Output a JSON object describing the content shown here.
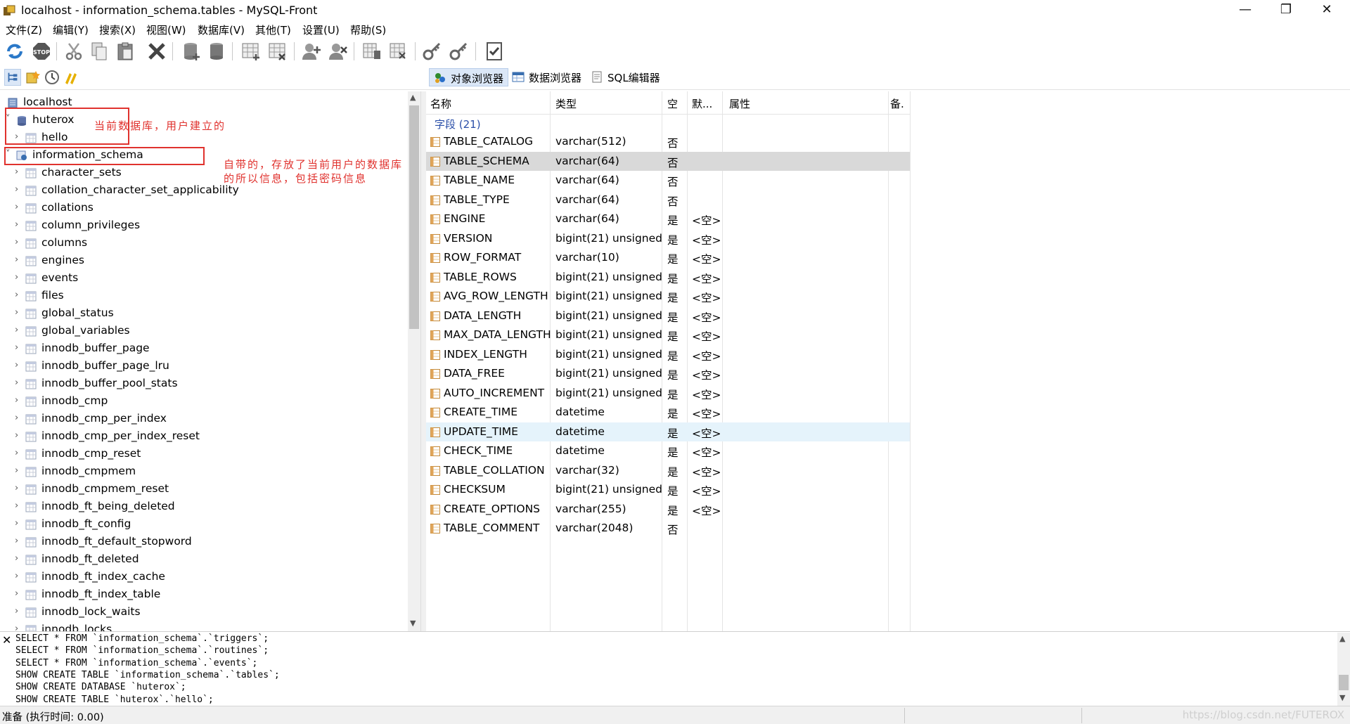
{
  "window": {
    "title": "localhost - information_schema.tables - MySQL-Front",
    "minimize": "—",
    "restore": "❐",
    "close": "✕"
  },
  "menu": [
    "文件(Z)",
    "编辑(Y)",
    "搜索(X)",
    "视图(W)",
    "数据库(V)",
    "其他(T)",
    "设置(U)",
    "帮助(S)"
  ],
  "view_tabs": [
    "对象浏览器",
    "数据浏览器",
    "SQL编辑器"
  ],
  "tree": {
    "root": "localhost",
    "user_db": "huterox",
    "user_db_table": "hello",
    "system_db": "information_schema",
    "tables": [
      "character_sets",
      "collation_character_set_applicability",
      "collations",
      "column_privileges",
      "columns",
      "engines",
      "events",
      "files",
      "global_status",
      "global_variables",
      "innodb_buffer_page",
      "innodb_buffer_page_lru",
      "innodb_buffer_pool_stats",
      "innodb_cmp",
      "innodb_cmp_per_index",
      "innodb_cmp_per_index_reset",
      "innodb_cmp_reset",
      "innodb_cmpmem",
      "innodb_cmpmem_reset",
      "innodb_ft_being_deleted",
      "innodb_ft_config",
      "innodb_ft_default_stopword",
      "innodb_ft_deleted",
      "innodb_ft_index_cache",
      "innodb_ft_index_table",
      "innodb_lock_waits",
      "innodb_locks"
    ]
  },
  "annotations": {
    "user_db_note": "当前数据库，用户建立的",
    "system_db_note_line1": "自带的，存放了当前用户的数据库",
    "system_db_note_line2": "的所以信息，包括密码信息"
  },
  "grid": {
    "headers": {
      "name": "名称",
      "type": "类型",
      "null": "空",
      "default": "默...",
      "attributes": "属性",
      "comment": "备."
    },
    "group_label": "字段 (21)",
    "rows": [
      {
        "name": "TABLE_CATALOG",
        "type": "varchar(512)",
        "null": "否",
        "default": ""
      },
      {
        "name": "TABLE_SCHEMA",
        "type": "varchar(64)",
        "null": "否",
        "default": ""
      },
      {
        "name": "TABLE_NAME",
        "type": "varchar(64)",
        "null": "否",
        "default": ""
      },
      {
        "name": "TABLE_TYPE",
        "type": "varchar(64)",
        "null": "否",
        "default": ""
      },
      {
        "name": "ENGINE",
        "type": "varchar(64)",
        "null": "是",
        "default": "<空>"
      },
      {
        "name": "VERSION",
        "type": "bigint(21) unsigned",
        "null": "是",
        "default": "<空>"
      },
      {
        "name": "ROW_FORMAT",
        "type": "varchar(10)",
        "null": "是",
        "default": "<空>"
      },
      {
        "name": "TABLE_ROWS",
        "type": "bigint(21) unsigned",
        "null": "是",
        "default": "<空>"
      },
      {
        "name": "AVG_ROW_LENGTH",
        "type": "bigint(21) unsigned",
        "null": "是",
        "default": "<空>"
      },
      {
        "name": "DATA_LENGTH",
        "type": "bigint(21) unsigned",
        "null": "是",
        "default": "<空>"
      },
      {
        "name": "MAX_DATA_LENGTH",
        "type": "bigint(21) unsigned",
        "null": "是",
        "default": "<空>"
      },
      {
        "name": "INDEX_LENGTH",
        "type": "bigint(21) unsigned",
        "null": "是",
        "default": "<空>"
      },
      {
        "name": "DATA_FREE",
        "type": "bigint(21) unsigned",
        "null": "是",
        "default": "<空>"
      },
      {
        "name": "AUTO_INCREMENT",
        "type": "bigint(21) unsigned",
        "null": "是",
        "default": "<空>"
      },
      {
        "name": "CREATE_TIME",
        "type": "datetime",
        "null": "是",
        "default": "<空>"
      },
      {
        "name": "UPDATE_TIME",
        "type": "datetime",
        "null": "是",
        "default": "<空>"
      },
      {
        "name": "CHECK_TIME",
        "type": "datetime",
        "null": "是",
        "default": "<空>"
      },
      {
        "name": "TABLE_COLLATION",
        "type": "varchar(32)",
        "null": "是",
        "default": "<空>"
      },
      {
        "name": "CHECKSUM",
        "type": "bigint(21) unsigned",
        "null": "是",
        "default": "<空>"
      },
      {
        "name": "CREATE_OPTIONS",
        "type": "varchar(255)",
        "null": "是",
        "default": "<空>"
      },
      {
        "name": "TABLE_COMMENT",
        "type": "varchar(2048)",
        "null": "否",
        "default": ""
      }
    ]
  },
  "sql_log": [
    "SELECT * FROM `information_schema`.`triggers`;",
    "SELECT * FROM `information_schema`.`routines`;",
    "SELECT * FROM `information_schema`.`events`;",
    "SHOW CREATE TABLE `information_schema`.`tables`;",
    "SHOW CREATE DATABASE `huterox`;",
    "SHOW CREATE TABLE `huterox`.`hello`;"
  ],
  "status": {
    "text": "准备  (执行时间: 0.00)",
    "watermark": "https://blog.csdn.net/FUTEROX"
  },
  "colors": {
    "annotation": "#e0322e",
    "selected_row": "#d9d9d9",
    "hover_row": "#e5f3fb",
    "group_label": "#2b4fa8"
  }
}
